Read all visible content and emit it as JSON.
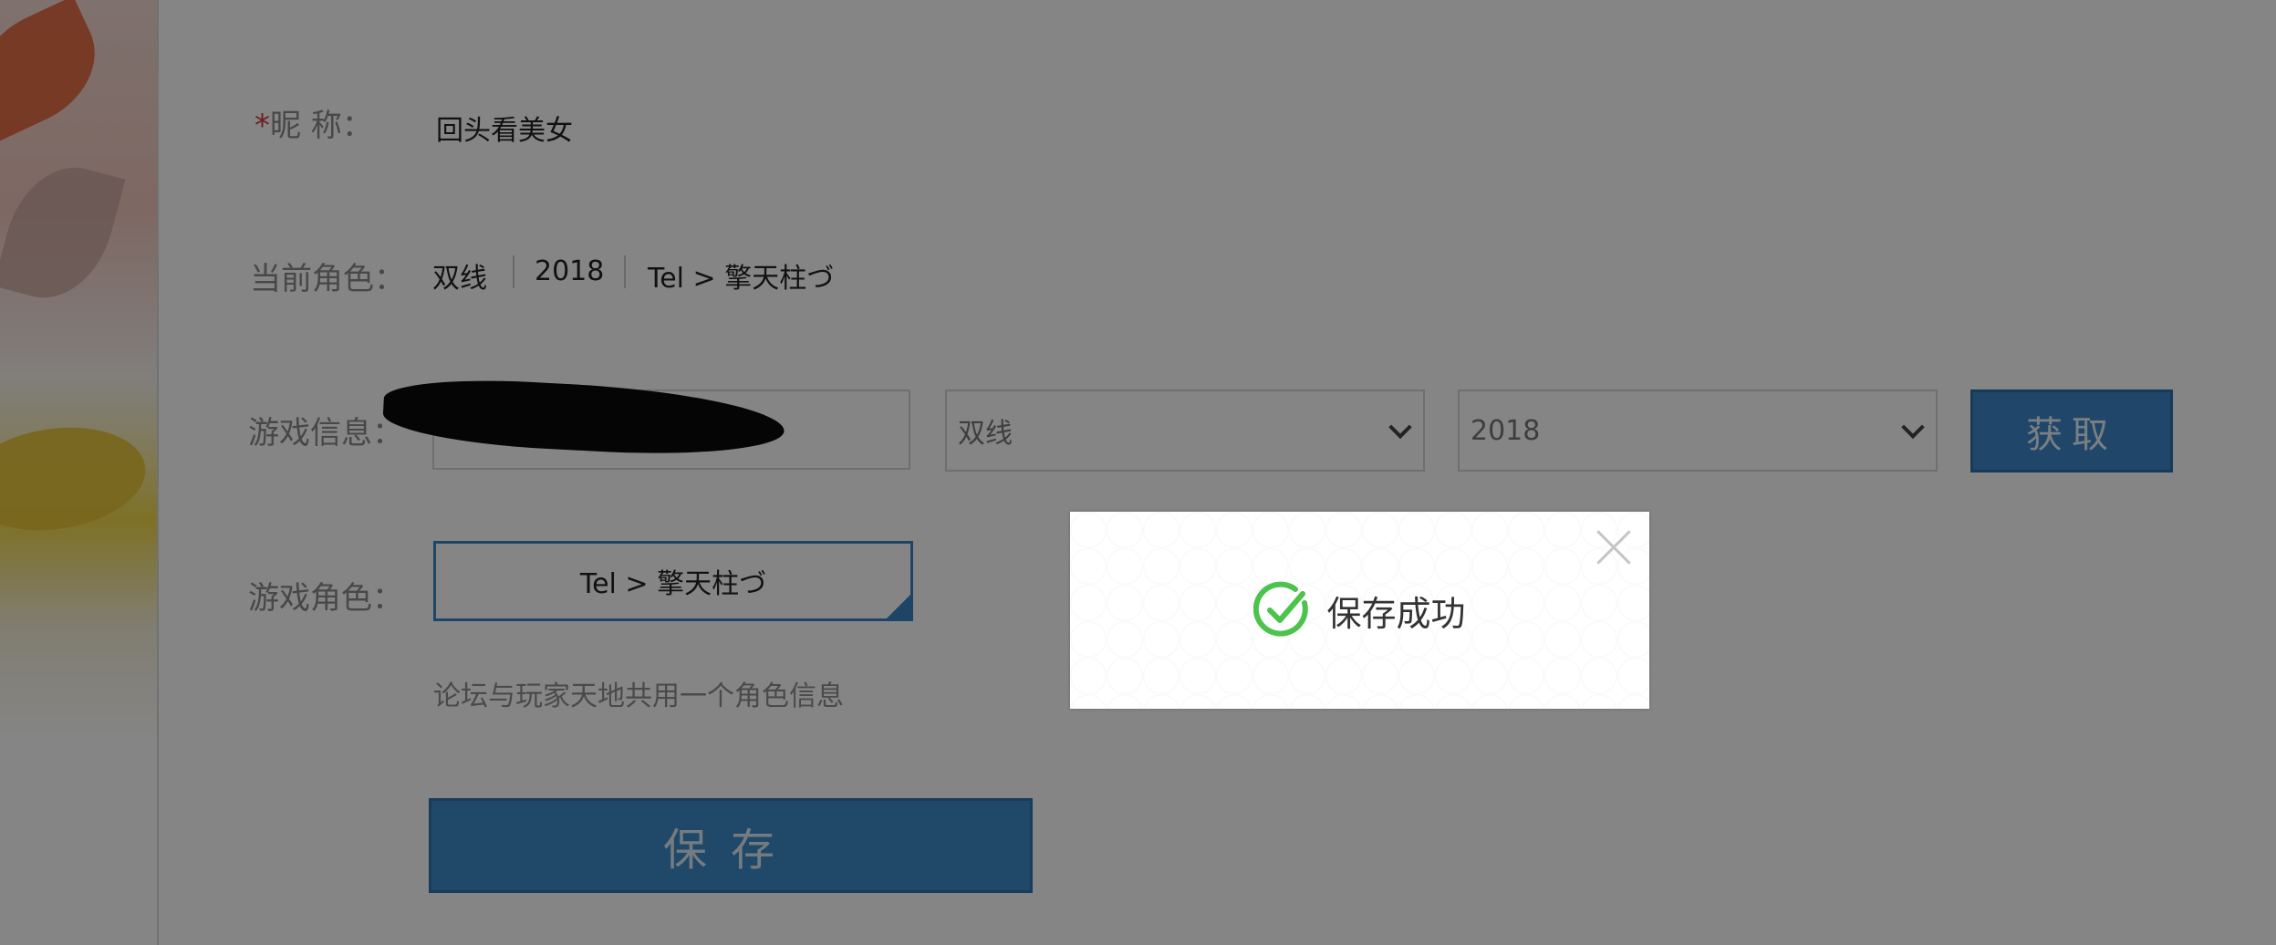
{
  "form": {
    "nickname": {
      "required_mark": "*",
      "label": "昵  称：",
      "value": "回头看美女"
    },
    "current_role": {
      "label": "当前角色：",
      "line": "双线",
      "server": "2018",
      "name": "Tel > 擎天柱づ"
    },
    "game_info": {
      "label": "游戏信息：",
      "account_value": "",
      "line_select": "双线",
      "server_select": "2018",
      "fetch_button": "获取"
    },
    "game_role": {
      "label": "游戏角色：",
      "selected": "Tel > 擎天柱づ",
      "hint": "论坛与玩家天地共用一个角色信息"
    },
    "save_button": "保存"
  },
  "toast": {
    "message": "保存成功",
    "icon": "check-circle-icon",
    "icon_color": "#4cc34c"
  },
  "colors": {
    "accent": "#3f89c9",
    "required": "#d23a3a",
    "overlay": "rgba(0,0,0,0.48)"
  }
}
